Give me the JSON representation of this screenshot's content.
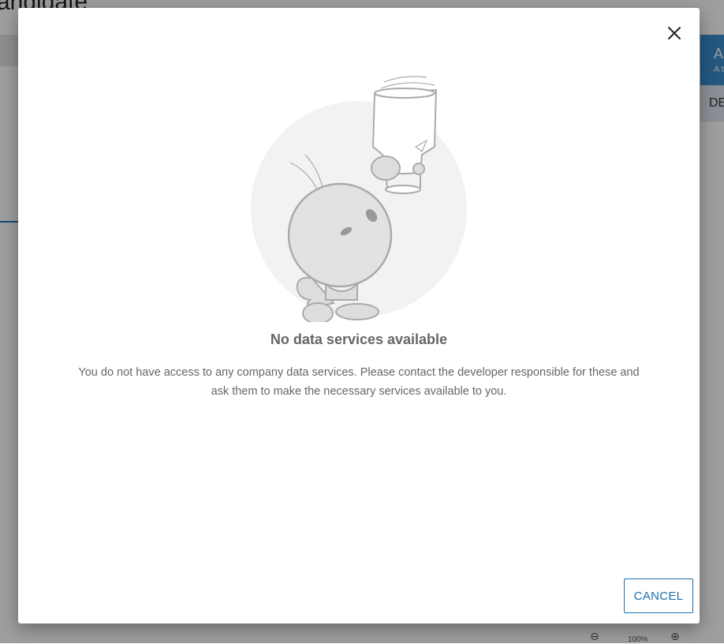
{
  "background": {
    "page_title": "andidate",
    "right_card_title": "A",
    "right_card_sub": "A t",
    "right_tab_label": "DE",
    "zoom_out_icon": "zoom-out-icon",
    "zoom_level": "100%",
    "zoom_in_icon": "zoom-in-icon"
  },
  "dialog": {
    "close_icon": "close-icon",
    "illustration_icon": "robot-empty-state-illustration",
    "title": "No data services available",
    "message": "You do not have access to any company data services. Please contact the developer responsible for these and ask them to make the necessary services available to you.",
    "cancel_label": "CANCEL"
  },
  "colors": {
    "accent": "#1b6fae",
    "text_muted": "#666666",
    "illustration_circle": "#f2f2f2",
    "illustration_stroke": "#aaaaaa"
  }
}
